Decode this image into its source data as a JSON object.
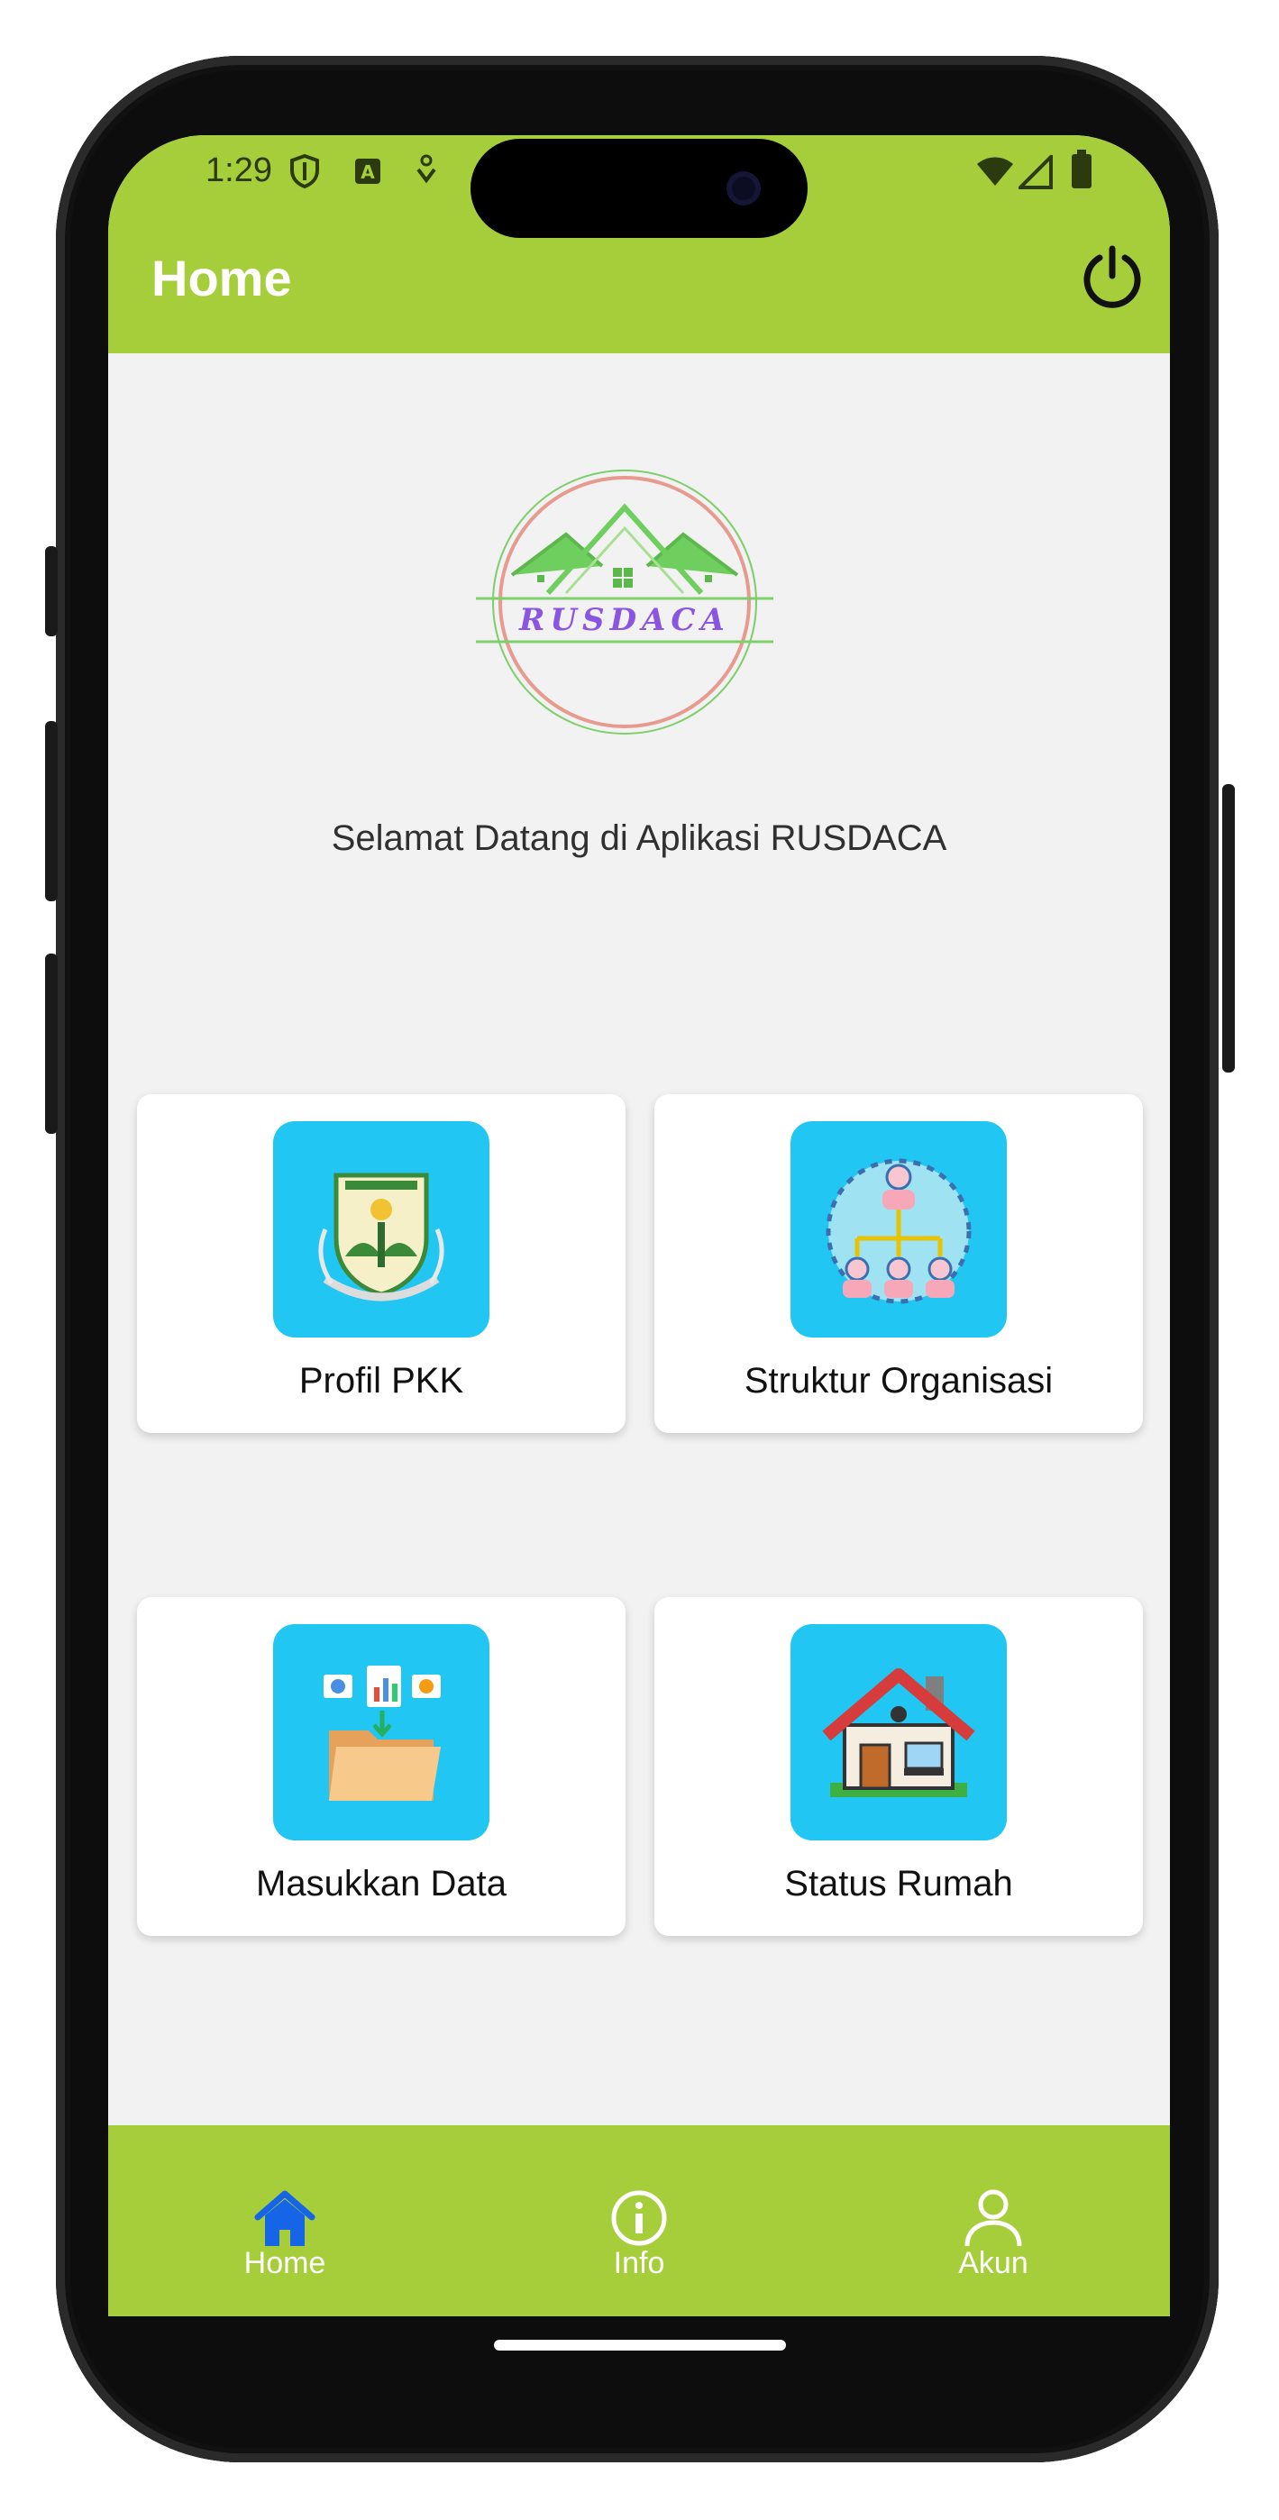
{
  "status_bar": {
    "time": "1:29",
    "left_icons": [
      "shield-icon",
      "app-a-icon",
      "notification-icon"
    ],
    "right_icons": [
      "wifi-icon",
      "signal-icon",
      "battery-icon"
    ]
  },
  "header": {
    "title": "Home",
    "action_icon": "power-icon"
  },
  "logo": {
    "text": "RUSDACA"
  },
  "welcome_text": "Selamat Datang di Aplikasi RUSDACA",
  "menu": [
    {
      "label": "Profil PKK",
      "icon": "emblem-icon"
    },
    {
      "label": "Struktur Organisasi",
      "icon": "org-chart-icon"
    },
    {
      "label": "Masukkan Data",
      "icon": "folder-data-icon"
    },
    {
      "label": "Status Rumah",
      "icon": "house-icon"
    }
  ],
  "bottom_nav": [
    {
      "label": "Home",
      "icon": "home-icon",
      "active": true
    },
    {
      "label": "Info",
      "icon": "info-icon",
      "active": false
    },
    {
      "label": "Akun",
      "icon": "user-icon",
      "active": false
    }
  ],
  "colors": {
    "primary": "#a6ce3a",
    "tile": "#21c6f2",
    "active_nav": "#1565e6",
    "background": "#f2f2f2",
    "logo_text": "#8a55e0"
  }
}
